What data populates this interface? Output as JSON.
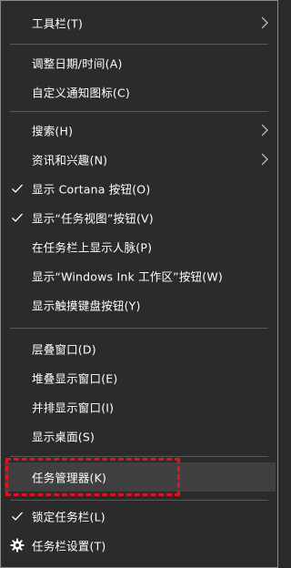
{
  "menu": {
    "items": [
      {
        "label": "工具栏(T)"
      },
      {
        "label": "调整日期/时间(A)"
      },
      {
        "label": "自定义通知图标(C)"
      },
      {
        "label": "搜索(H)"
      },
      {
        "label": "资讯和兴趣(N)"
      },
      {
        "label": "显示 Cortana 按钮(O)"
      },
      {
        "label": "显示“任务视图”按钮(V)"
      },
      {
        "label": "在任务栏上显示人脉(P)"
      },
      {
        "label": "显示“Windows Ink 工作区”按钮(W)"
      },
      {
        "label": "显示触摸键盘按钮(Y)"
      },
      {
        "label": "层叠窗口(D)"
      },
      {
        "label": "堆叠显示窗口(E)"
      },
      {
        "label": "并排显示窗口(I)"
      },
      {
        "label": "显示桌面(S)"
      },
      {
        "label": "任务管理器(K)"
      },
      {
        "label": "锁定任务栏(L)"
      },
      {
        "label": "任务栏设置(T)"
      }
    ]
  },
  "icons": {
    "check": "checkmark-icon",
    "arrow": "chevron-right-icon",
    "gear": "gear-icon"
  },
  "colors": {
    "background": "#2b2b2b",
    "hover": "#404040",
    "highlight_border": "#e0141e",
    "separator": "#5a5a5a",
    "text": "#ffffff"
  }
}
